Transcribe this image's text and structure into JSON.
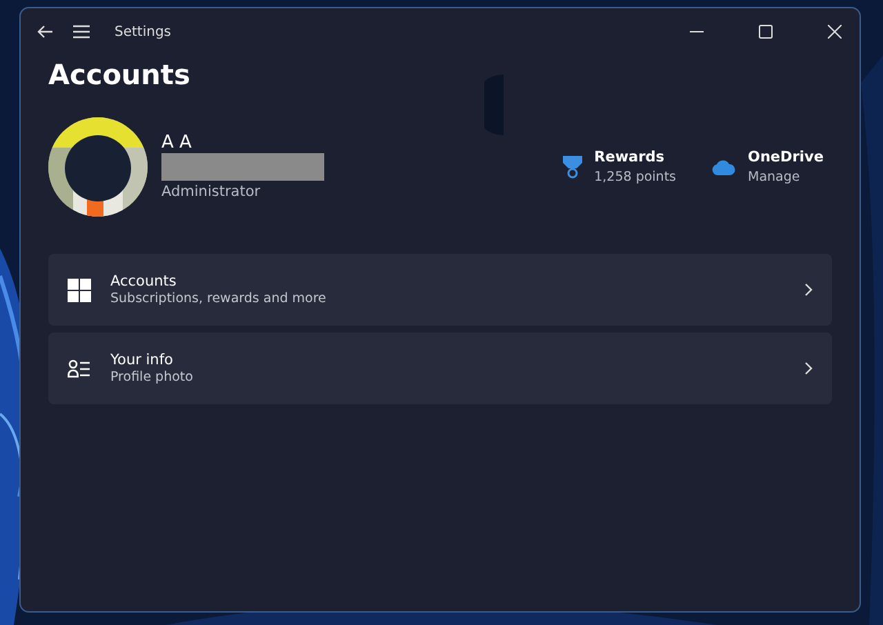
{
  "window": {
    "title": "Settings"
  },
  "page": {
    "title": "Accounts"
  },
  "profile": {
    "name": "A A",
    "role": "Administrator"
  },
  "services": [
    {
      "kind": "rewards",
      "title": "Rewards",
      "subtitle": "1,258 points"
    },
    {
      "kind": "cloud",
      "title": "OneDrive",
      "subtitle": "Manage"
    }
  ],
  "items": [
    {
      "kind": "grid",
      "title": "Accounts",
      "subtitle": "Subscriptions, rewards and more"
    },
    {
      "kind": "person-list",
      "title": "Your info",
      "subtitle": "Profile photo"
    }
  ]
}
